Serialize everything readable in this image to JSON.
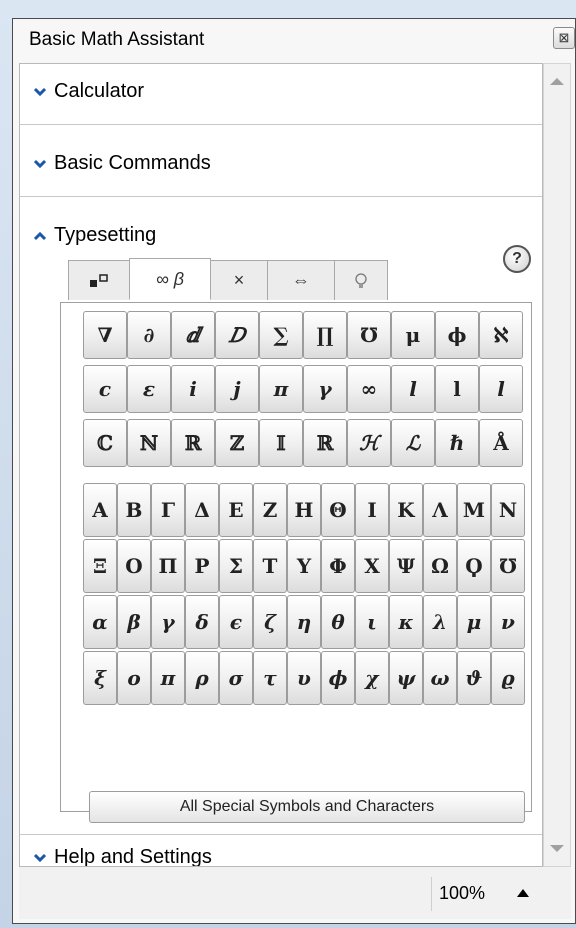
{
  "window": {
    "title": "Basic Math Assistant",
    "close_glyph": "⊠"
  },
  "sections": {
    "calculator": "Calculator",
    "basic_commands": "Basic Commands",
    "typesetting": "Typesetting",
    "help_settings": "Help and Settings"
  },
  "help_label": "?",
  "tabs": [
    "▪▫",
    "∞ β",
    "×",
    "⇔",
    "♀"
  ],
  "palette": {
    "row1": [
      "∇",
      "∂",
      "ⅆ",
      "𝐷",
      "∑",
      "∏",
      "℧",
      "μ",
      "ϕ",
      "ℵ"
    ],
    "row2": [
      "𝒄",
      "ε",
      "𝒊",
      "𝒋",
      "π",
      "γ",
      "∞",
      "ⅼ",
      "ⅼ",
      "ⅼ"
    ],
    "row3": [
      "ℂ",
      "ℕ",
      "ℝ",
      "ℤ",
      "𝕀",
      "ℝ",
      "ℋ",
      "ℒ",
      "ℏ",
      "Å"
    ],
    "greek_upper1": [
      "Α",
      "Β",
      "Γ",
      "Δ",
      "Ε",
      "Ζ",
      "Η",
      "Θ",
      "Ι",
      "Κ",
      "Λ",
      "Μ",
      "Ν"
    ],
    "greek_upper2": [
      "Ξ",
      "Ο",
      "Π",
      "Ρ",
      "Σ",
      "Τ",
      "Υ",
      "Φ",
      "Χ",
      "Ψ",
      "Ω",
      "Ϙ",
      "℧"
    ],
    "greek_lower1": [
      "α",
      "β",
      "γ",
      "δ",
      "ϵ",
      "ζ",
      "η",
      "θ",
      "ι",
      "κ",
      "λ",
      "μ",
      "ν"
    ],
    "greek_lower2": [
      "ξ",
      "ο",
      "π",
      "ρ",
      "σ",
      "τ",
      "υ",
      "ϕ",
      "χ",
      "ψ",
      "ω",
      "ϑ",
      "ϱ"
    ],
    "all_symbols_label": "All Special Symbols and Characters"
  },
  "status": {
    "zoom": "100%"
  }
}
